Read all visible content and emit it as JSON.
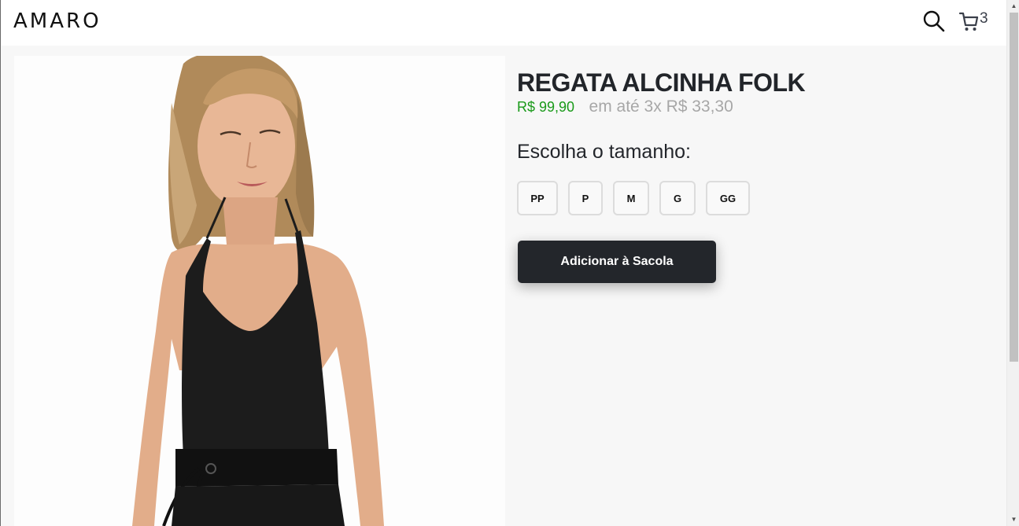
{
  "header": {
    "logo": "AMARO",
    "cart_count": "3",
    "search_icon": "search-icon",
    "cart_icon": "cart-icon"
  },
  "product": {
    "title": "REGATA ALCINHA FOLK",
    "price": "R$ 99,90",
    "installments": "em até 3x R$ 33,30",
    "size_heading": "Escolha o tamanho:",
    "sizes": [
      "PP",
      "P",
      "M",
      "G",
      "GG"
    ],
    "add_to_bag": "Adicionar à Sacola",
    "image_description_icon": "product-photo"
  },
  "colors": {
    "price": "#1a9a1a",
    "button_bg": "#23262b",
    "installments": "#a7a7a7"
  }
}
